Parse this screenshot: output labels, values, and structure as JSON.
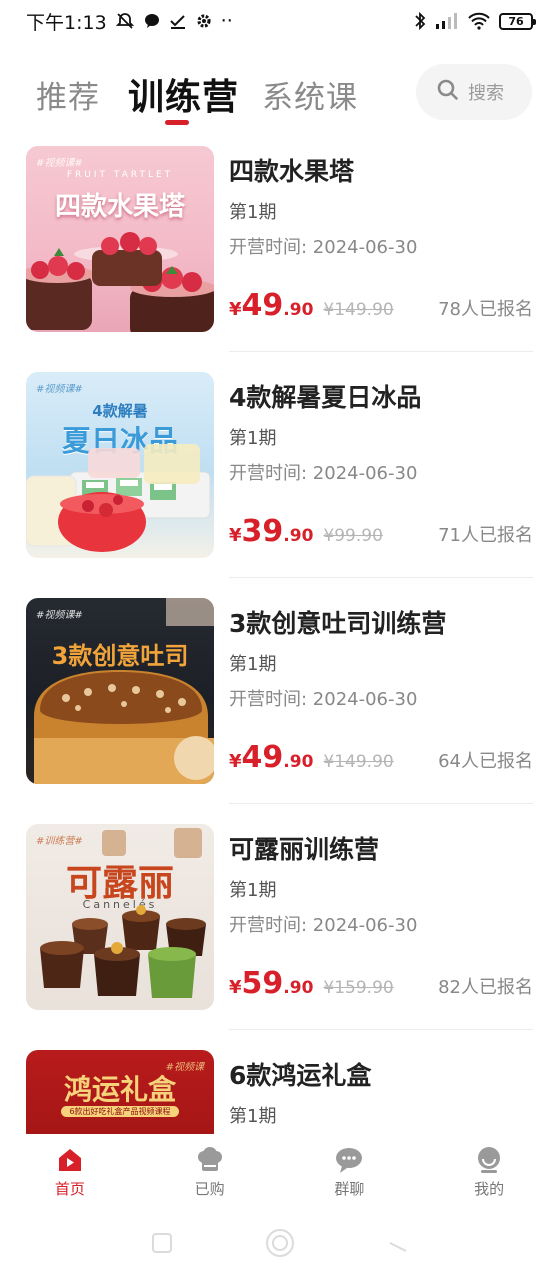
{
  "status_bar": {
    "time": "下午1:13",
    "dots": "··",
    "battery": "76",
    "icons": [
      "bell-muted-icon",
      "chat-bubble-icon",
      "check-download-icon",
      "gear-icon",
      "bluetooth-icon",
      "signal-icon",
      "wifi-icon",
      "battery-icon"
    ]
  },
  "tabs": [
    {
      "label": "推荐",
      "active": false
    },
    {
      "label": "训练营",
      "active": true
    },
    {
      "label": "系统课",
      "active": false
    }
  ],
  "search": {
    "label": "搜索",
    "icon": "search-icon"
  },
  "courses": [
    {
      "title": "四款水果塔",
      "period": "第1期",
      "start": "开营时间: 2024-06-30",
      "currency": "¥",
      "price_int": "49",
      "price_dec": ".90",
      "old_price": "¥149.90",
      "enrolled": "78人已报名",
      "thumb_tag": "#视频课#",
      "thumb_sub": "FRUIT TARTLET",
      "thumb_title": "四款水果塔"
    },
    {
      "title": "4款解暑夏日冰品",
      "period": "第1期",
      "start": "开营时间: 2024-06-30",
      "currency": "¥",
      "price_int": "39",
      "price_dec": ".90",
      "old_price": "¥99.90",
      "enrolled": "71人已报名",
      "thumb_tag": "#视频课#",
      "thumb_sub": "4款解暑",
      "thumb_title": "夏日冰品"
    },
    {
      "title": "3款创意吐司训练营",
      "period": "第1期",
      "start": "开营时间: 2024-06-30",
      "currency": "¥",
      "price_int": "49",
      "price_dec": ".90",
      "old_price": "¥149.90",
      "enrolled": "64人已报名",
      "thumb_tag": "#视频课#",
      "thumb_title": "3款创意吐司"
    },
    {
      "title": "可露丽训练营",
      "period": "第1期",
      "start": "开营时间: 2024-06-30",
      "currency": "¥",
      "price_int": "59",
      "price_dec": ".90",
      "old_price": "¥159.90",
      "enrolled": "82人已报名",
      "thumb_tag": "#训练营#",
      "thumb_title": "可露丽",
      "thumb_sub": "Cannelés"
    },
    {
      "title": "6款鸿运礼盒",
      "period": "第1期",
      "thumb_tag": "#视频课",
      "thumb_title": "鸿运礼盒",
      "thumb_sub": "6款出好吃礼盒产品视频课程"
    }
  ],
  "bottom_nav": [
    {
      "label": "首页",
      "icon": "home-icon",
      "active": true
    },
    {
      "label": "已购",
      "icon": "chef-hat-icon",
      "active": false
    },
    {
      "label": "群聊",
      "icon": "chat-icon",
      "active": false
    },
    {
      "label": "我的",
      "icon": "profile-icon",
      "active": false
    }
  ],
  "colors": {
    "accent": "#d8202a",
    "muted_text": "#888888",
    "strike_text": "#b5b5b5",
    "search_bg": "#f4f4f4"
  }
}
